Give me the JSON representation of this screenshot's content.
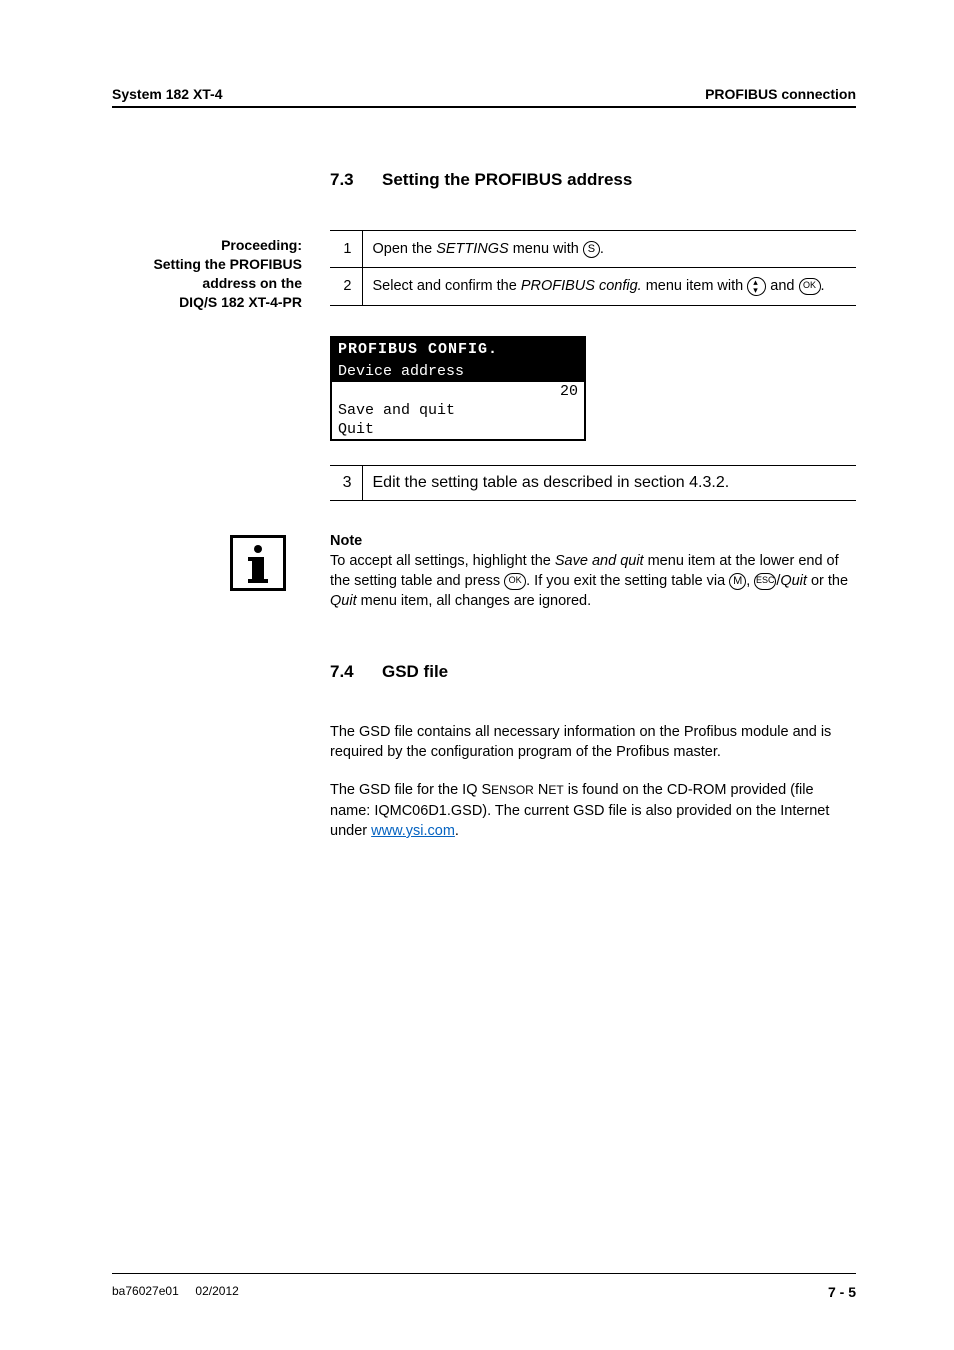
{
  "header": {
    "left": "System 182 XT-4",
    "right": "PROFIBUS connection"
  },
  "sec73": {
    "num": "7.3",
    "title": "Setting the PROFIBUS address",
    "sidebar_l1": "Proceeding:",
    "sidebar_l2": "Setting the PROFIBUS",
    "sidebar_l3": "address on the",
    "sidebar_l4": "DIQ/S 182 XT-4-PR",
    "step1_num": "1",
    "step1_a": "Open the ",
    "step1_settings": "SETTINGS",
    "step1_b": " menu with ",
    "step1_key": "S",
    "step1_c": ".",
    "step2_num": "2",
    "step2_a": "Select and confirm the ",
    "step2_item": "PROFIBUS config.",
    "step2_b": " menu item with ",
    "step2_c": " and ",
    "step2_ok": "OK",
    "step2_d": ".",
    "step3_num": "3",
    "step3_text": "Edit the setting table as described in section 4.3.2."
  },
  "lcd": {
    "title": "PROFIBUS CONFIG.",
    "row1": "Device address",
    "row2_value": "20",
    "row3": "Save and quit",
    "row4": "Quit"
  },
  "note": {
    "lead": "Note",
    "a": "To accept all settings, highlight the ",
    "saq": "Save and quit",
    "b": " menu item at the lower end of the setting table and press ",
    "ok": "OK",
    "c": ". If you exit the setting table via ",
    "m": "M",
    "d": ", ",
    "esc": "ESC",
    "slash": "/",
    "quit": "Quit",
    "e": " or the ",
    "quit2": "Quit",
    "f": " menu item, all changes are ignored."
  },
  "sec74": {
    "num": "7.4",
    "title": "GSD file",
    "p1": "The GSD file contains all necessary information on the Profibus module and is required by the configuration program of the Profibus master.",
    "p2a": "The GSD file for the IQ S",
    "p2a_sc": "ENSOR",
    "p2b": " N",
    "p2b_sc": "ET",
    "p2c": " is found on the CD-ROM provided (file name: IQMC06D1.GSD). The current GSD file is also provided on the Internet under ",
    "link": "www.ysi.com",
    "p2d": "."
  },
  "footer": {
    "left": "ba76027e01",
    "mid": "02/2012",
    "page": "7 - 5"
  }
}
